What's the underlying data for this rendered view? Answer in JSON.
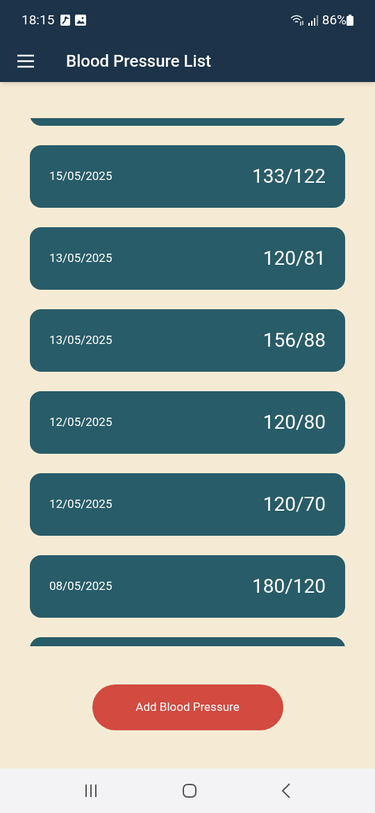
{
  "status_bar": {
    "time": "18:15",
    "battery": "86%"
  },
  "app_bar": {
    "title": "Blood Pressure List"
  },
  "readings": [
    {
      "date": "15/05/2025",
      "value": "133/122"
    },
    {
      "date": "13/05/2025",
      "value": "120/81"
    },
    {
      "date": "13/05/2025",
      "value": "156/88"
    },
    {
      "date": "12/05/2025",
      "value": "120/80"
    },
    {
      "date": "12/05/2025",
      "value": "120/70"
    },
    {
      "date": "08/05/2025",
      "value": "180/120"
    }
  ],
  "add_button": {
    "label": "Add Blood Pressure"
  }
}
